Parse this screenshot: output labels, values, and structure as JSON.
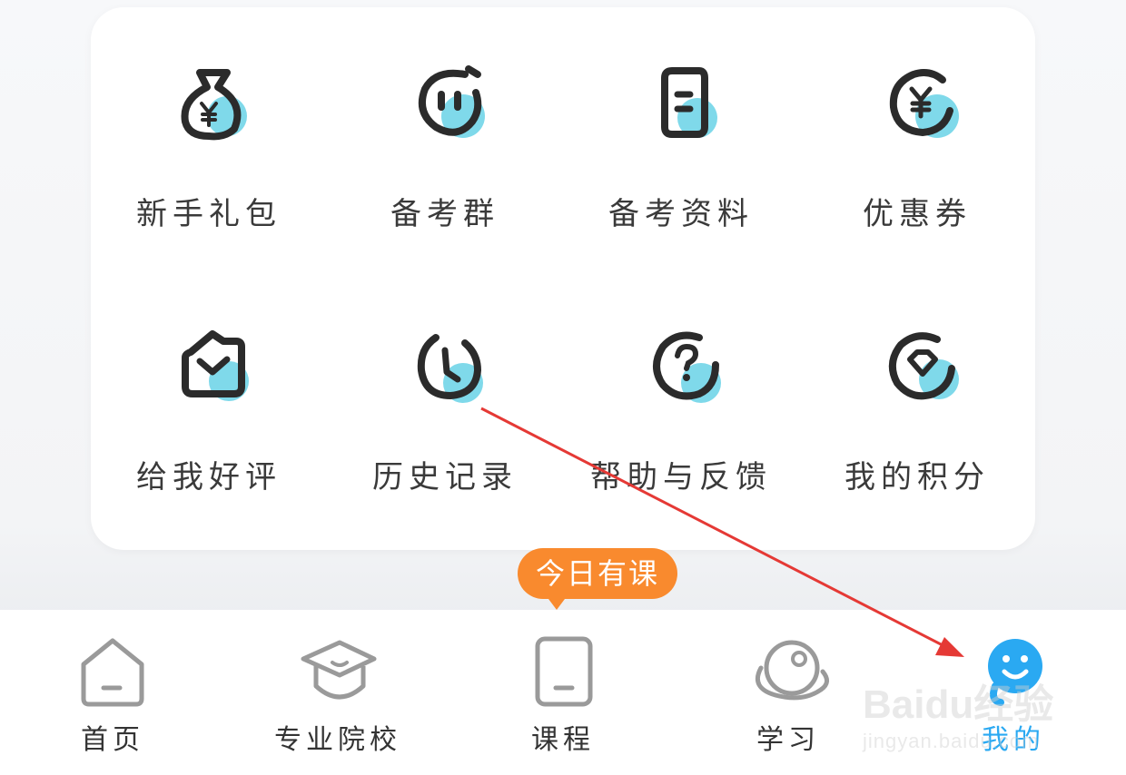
{
  "menu": {
    "items": [
      {
        "label": "新手礼包",
        "icon": "gift-bag-icon"
      },
      {
        "label": "备考群",
        "icon": "chat-group-icon"
      },
      {
        "label": "备考资料",
        "icon": "document-icon"
      },
      {
        "label": "优惠券",
        "icon": "coupon-icon"
      },
      {
        "label": "给我好评",
        "icon": "envelope-rating-icon"
      },
      {
        "label": "历史记录",
        "icon": "history-clock-icon"
      },
      {
        "label": "帮助与反馈",
        "icon": "help-icon"
      },
      {
        "label": "我的积分",
        "icon": "points-diamond-icon"
      }
    ]
  },
  "badge": {
    "label": "今日有课"
  },
  "tabbar": {
    "tabs": [
      {
        "label": "首页",
        "icon": "home-icon"
      },
      {
        "label": "专业院校",
        "icon": "graduation-cap-icon"
      },
      {
        "label": "课程",
        "icon": "course-icon"
      },
      {
        "label": "学习",
        "icon": "study-planet-icon"
      },
      {
        "label": "我的",
        "icon": "profile-face-icon"
      }
    ],
    "active_index": 4
  },
  "colors": {
    "accent_cyan": "#7fd9ea",
    "tab_active": "#2aa9f2",
    "badge": "#f98a2e",
    "annotation_arrow": "#e53935"
  },
  "watermark": {
    "main": "Baidu经验",
    "sub": "jingyan.baidu.com"
  }
}
